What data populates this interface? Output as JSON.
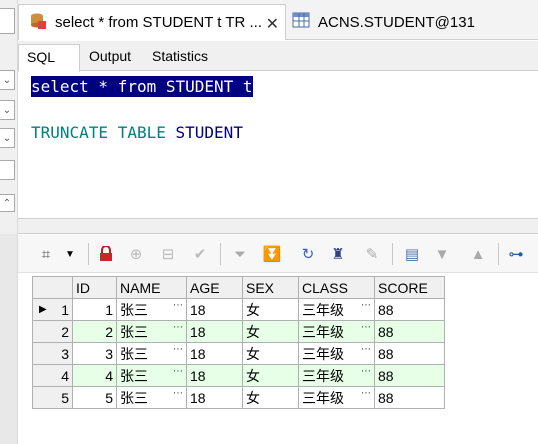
{
  "tabs": [
    {
      "label": "select * from STUDENT t TR ...",
      "icon": "sql-window-icon",
      "active": true
    },
    {
      "label": "ACNS.STUDENT@131",
      "icon": "table-icon",
      "active": false
    }
  ],
  "subtabs": [
    "SQL",
    "Output",
    "Statistics"
  ],
  "editor": {
    "line1": "select * from STUDENT t",
    "line2_kw1": "TRUNCATE",
    "line2_kw2": "TABLE",
    "line2_ident": "STUDENT"
  },
  "grid": {
    "columns": [
      "ID",
      "NAME",
      "AGE",
      "SEX",
      "CLASS",
      "SCORE"
    ],
    "rows": [
      {
        "num": "1",
        "id": "1",
        "name": "张三",
        "age": "18",
        "sex": "女",
        "class": "三年级",
        "score": "88"
      },
      {
        "num": "2",
        "id": "2",
        "name": "张三",
        "age": "18",
        "sex": "女",
        "class": "三年级",
        "score": "88"
      },
      {
        "num": "3",
        "id": "3",
        "name": "张三",
        "age": "18",
        "sex": "女",
        "class": "三年级",
        "score": "88"
      },
      {
        "num": "4",
        "id": "4",
        "name": "张三",
        "age": "18",
        "sex": "女",
        "class": "三年级",
        "score": "88"
      },
      {
        "num": "5",
        "id": "5",
        "name": "张三",
        "age": "18",
        "sex": "女",
        "class": "三年级",
        "score": "88"
      }
    ]
  },
  "colors": {
    "selection": "#000080",
    "keyword": "#008080",
    "alt_row": "#e6ffe6"
  }
}
